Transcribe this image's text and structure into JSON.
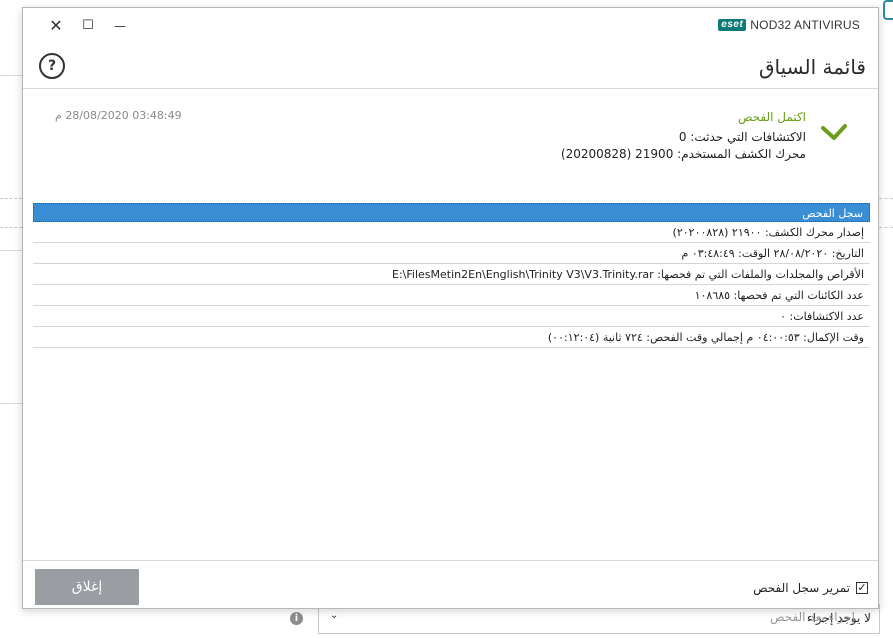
{
  "background": {
    "post_scan_label": "إجراء بعد الفحص",
    "post_scan_value": "لا يوجد إجراء",
    "info_icon": "info-icon"
  },
  "window": {
    "close_icon": "✕",
    "maximize_icon": "☐",
    "minimize_icon": "—",
    "brand_logo": "eset",
    "product": "NOD32 ANTIVIRUS"
  },
  "header": {
    "title": "قائمة السياق",
    "help_icon": "?"
  },
  "scan_status": {
    "title": "اكتمل الفحص",
    "detections": "الاكتشافات التي حدثت: 0",
    "engine": "محرك الكشف المستخدم: 21900 (20200828)",
    "timestamp": "03:48:49 28/08/2020 م",
    "accent": "#6a9f1e"
  },
  "log": {
    "header": "سجل الفحص",
    "rows": [
      "إصدار محرك الكشف: ٢١٩٠٠ (٢٠٢٠٠٨٢٨)",
      "التاريخ: ٢٨/٠٨/٢٠٢٠  الوقت: ٠٣:٤٨:٤٩ م",
      "الأقراص والمجلدات والملفات التي تم فحصها: E:\\FilesMetin2En\\English\\Trinity V3\\V3.Trinity.rar",
      "عدد الكائنات التي تم فحصها: ١٠٨٦٨٥",
      "عدد الاكتشافات: ٠",
      "وقت الإكمال: ٠٤:٠٠:٥٣ م  إجمالي وقت الفحص: ٧٢٤ ثانية (٠٠:١٢:٠٤)"
    ]
  },
  "footer": {
    "close_label": "إغلاق",
    "scroll_label": "تمرير سجل الفحص",
    "scroll_checked": "✓"
  }
}
